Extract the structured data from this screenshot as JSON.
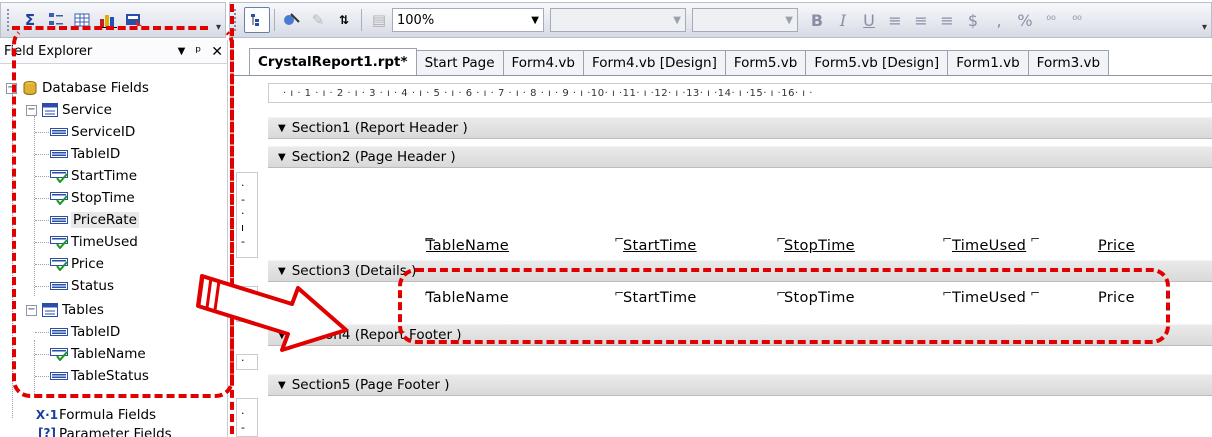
{
  "toolbar_left": {
    "buttons": [
      {
        "name": "sum-icon",
        "glyph": "Σ"
      },
      {
        "name": "group-tree-icon",
        "glyph": "⊟"
      },
      {
        "name": "grid-icon",
        "glyph": "⊞"
      },
      {
        "name": "chart-icon",
        "glyph": "▥"
      },
      {
        "name": "field-explorer-icon",
        "glyph": "▣"
      }
    ]
  },
  "toolbar_right": {
    "zoom": "100%",
    "format_glyphs": [
      "B",
      "I",
      "U",
      "≡",
      "≡",
      "≡",
      "$",
      ",",
      "%",
      "⁰⁰",
      "⁰⁰"
    ]
  },
  "explorer": {
    "title": "Field Explorer",
    "pin_glyph": "▾ ⊥",
    "close_glyph": "✕",
    "root": "Database Fields",
    "service": {
      "label": "Service",
      "fields": [
        "ServiceID",
        "TableID",
        "StartTime",
        "StopTime",
        "PriceRate",
        "TimeUsed",
        "Price",
        "Status"
      ]
    },
    "tables": {
      "label": "Tables",
      "fields": [
        "TableID",
        "TableName",
        "TableStatus"
      ]
    },
    "formula": "Formula Fields",
    "parameter": "Parameter Fields"
  },
  "tabs": [
    {
      "label": "CrystalReport1.rpt*",
      "active": true
    },
    {
      "label": "Start Page"
    },
    {
      "label": "Form4.vb"
    },
    {
      "label": "Form4.vb [Design]"
    },
    {
      "label": "Form5.vb"
    },
    {
      "label": "Form5.vb [Design]"
    },
    {
      "label": "Form1.vb"
    },
    {
      "label": "Form3.vb"
    }
  ],
  "ruler": "· ı · 1 · ı · 2 · ı · 3 · ı · 4 · ı · 5 · ı · 6 · ı · 7 · ı · 8 · ı · 9 · ı ·10· ı ·11· ı ·12· ı ·13· ı ·14· ı ·15· ı ·16· ı ·",
  "sections": {
    "s1": "Section1 (Report Header )",
    "s2": "Section2 (Page Header )",
    "s3": "Section3 (Details )",
    "s4": "Section4 (Report Footer )",
    "s5": "Section5 (Page Footer )"
  },
  "header_fields": {
    "table_name": "TableName",
    "start_time": "StartTime",
    "stop_time": "StopTime",
    "time_used": "TimeUsed",
    "price": "Price"
  },
  "detail_fields": {
    "table_name": "TableName",
    "start_time": "StartTime",
    "stop_time": "StopTime",
    "time_used": "TimeUsed",
    "price": "Price"
  },
  "colors": {
    "annotation": "#e00000",
    "section_band": "#dadada",
    "tree_lines": "#9aa0ad"
  }
}
